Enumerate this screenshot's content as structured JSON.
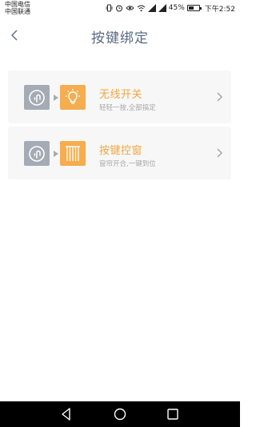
{
  "status_bar": {
    "carrier_1": "中国电信",
    "carrier_2": "中国联通",
    "battery": "45%",
    "time": "下午2:52"
  },
  "header": {
    "title": "按键绑定"
  },
  "cards": [
    {
      "title": "无线开关",
      "subtitle": "轻轻一按,全部搞定",
      "icon": "lightbulb-icon"
    },
    {
      "title": "按键控窗",
      "subtitle": "窗帘开合,一键到位",
      "icon": "curtain-icon"
    }
  ],
  "colors": {
    "accent": "#f0a640",
    "icon_gray": "#a4abb5",
    "title": "#5a6b80"
  }
}
